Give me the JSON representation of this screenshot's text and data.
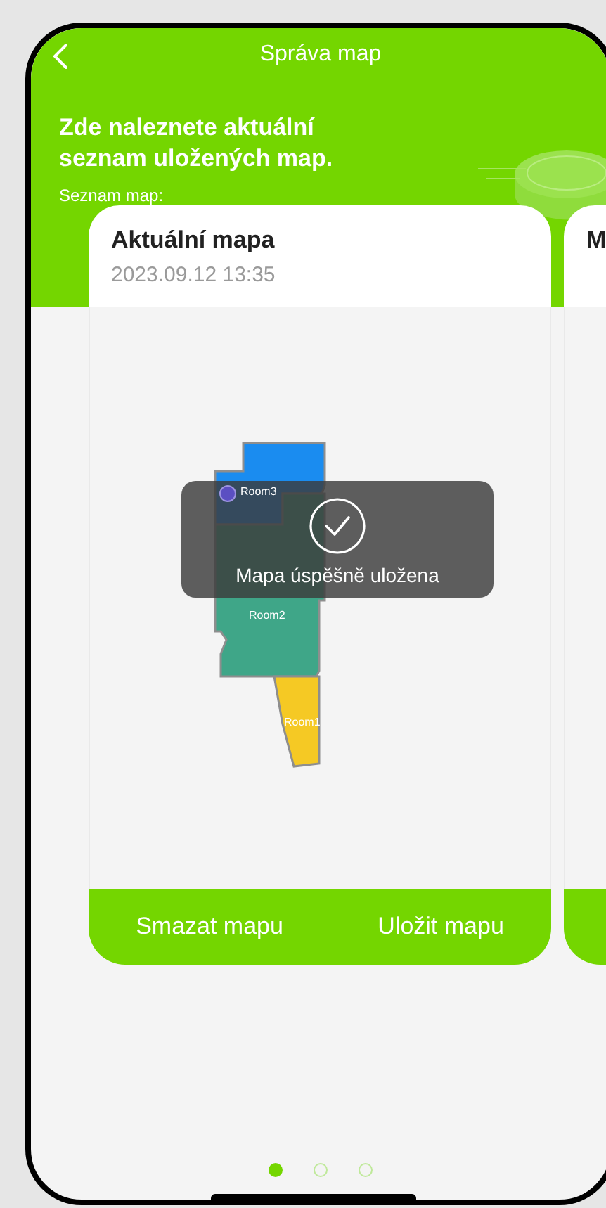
{
  "header": {
    "title": "Správa map"
  },
  "intro": {
    "heading": "Zde naleznete aktuální seznam uložených map.",
    "list_label": "Seznam map:"
  },
  "maps": [
    {
      "title": "Aktuální mapa",
      "date": "2023.09.12 13:35",
      "rooms": [
        {
          "label": "Room3",
          "color": "#1a8cf0"
        },
        {
          "label": "Room2",
          "color": "#3fa688"
        },
        {
          "label": "Room1",
          "color": "#f5c924"
        }
      ],
      "actions": [
        "Smazat mapu",
        "Uložit mapu"
      ]
    },
    {
      "title": "M"
    }
  ],
  "toast": {
    "message": "Mapa úspěšně uložena"
  },
  "pages": [
    {
      "selected": true
    },
    {
      "selected": false
    },
    {
      "selected": false
    }
  ]
}
